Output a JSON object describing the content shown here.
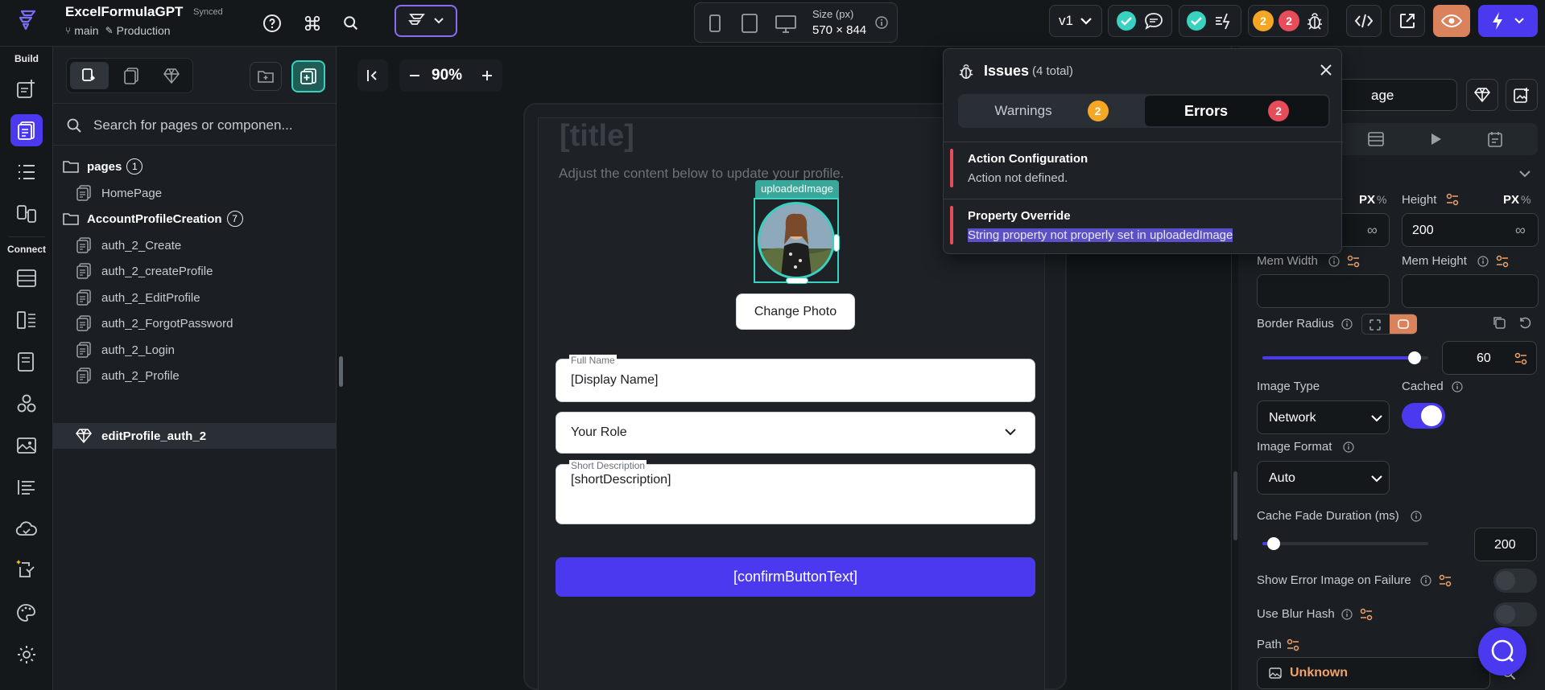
{
  "project": {
    "name": "ExcelFormulaGPT",
    "sync_status": "Synced",
    "branch": "main",
    "environment": "Production"
  },
  "topbar": {
    "size_label": "Size (px)",
    "size_value": "570 × 844",
    "version": "v1",
    "warning_count": "2",
    "error_count": "2",
    "icons": [
      "help-icon",
      "command-icon",
      "search-icon",
      "widget-mode-icon",
      "phone-icon",
      "tablet-icon",
      "desktop-icon",
      "info-icon",
      "check-icon",
      "comment-icon",
      "lightning-icon",
      "bug-icon",
      "code-icon",
      "open-external-icon",
      "preview-eye-icon",
      "run-lightning-icon"
    ]
  },
  "rail": {
    "build_label": "Build",
    "connect_label": "Connect"
  },
  "tree": {
    "search_placeholder": "Search for pages or componen...",
    "folders": [
      {
        "name": "pages",
        "count": "1"
      },
      {
        "name": "AccountProfileCreation",
        "count": "7"
      }
    ],
    "items": [
      {
        "name": "HomePage",
        "kind": "page"
      },
      {
        "name": "auth_2_Create",
        "kind": "page"
      },
      {
        "name": "auth_2_createProfile",
        "kind": "page"
      },
      {
        "name": "auth_2_EditProfile",
        "kind": "page"
      },
      {
        "name": "auth_2_ForgotPassword",
        "kind": "page"
      },
      {
        "name": "auth_2_Login",
        "kind": "page"
      },
      {
        "name": "auth_2_Profile",
        "kind": "page"
      },
      {
        "name": "editProfile_auth_2",
        "kind": "component",
        "selected": true
      }
    ]
  },
  "canvas": {
    "zoom": "90%",
    "title": "[title]",
    "subtitle": "Adjust the content below to update your profile.",
    "image_label": "uploadedImage",
    "change_photo": "Change Photo",
    "full_name_label": "Full Name",
    "full_name_value": "[Display Name]",
    "role_value": "Your Role",
    "short_desc_label": "Short Description",
    "short_desc_value": "[shortDescription]",
    "confirm_button": "[confirmButtonText]"
  },
  "issues": {
    "title": "Issues",
    "total": "(4 total)",
    "tabs": [
      {
        "label": "Warnings",
        "count": "2"
      },
      {
        "label": "Errors",
        "count": "2",
        "active": true
      }
    ],
    "list": [
      {
        "title": "Action Configuration",
        "detail": "Action not defined."
      },
      {
        "title": "Property Override",
        "detail": "String property not properly set in uploadedImage"
      }
    ]
  },
  "props": {
    "name_value": "age",
    "width_unit_px": "PX",
    "width_unit_pct": "%",
    "height_label": "Height",
    "height_unit_px": "PX",
    "height_unit_pct": "%",
    "width_value": "∞",
    "height_value": "200",
    "height_inf": "∞",
    "mem_width_label": "Mem Width",
    "mem_height_label": "Mem Height",
    "border_radius_label": "Border Radius",
    "border_radius_value": "60",
    "border_radius_fraction": 0.95,
    "image_type_label": "Image Type",
    "image_type_value": "Network",
    "cached_label": "Cached",
    "cached_on": true,
    "image_format_label": "Image Format",
    "image_format_value": "Auto",
    "cache_fade_label": "Cache Fade Duration (ms)",
    "cache_fade_value": "200",
    "cache_fade_fraction": 0.03,
    "show_error_label": "Show Error Image on Failure",
    "use_blur_label": "Use Blur Hash",
    "path_label": "Path",
    "path_value": "Unknown"
  },
  "colors": {
    "accent": "#4b39ef",
    "teal": "#39d2c0",
    "warning": "#f5a623",
    "error": "#e74c5b",
    "highlight": "#5b50c8"
  }
}
